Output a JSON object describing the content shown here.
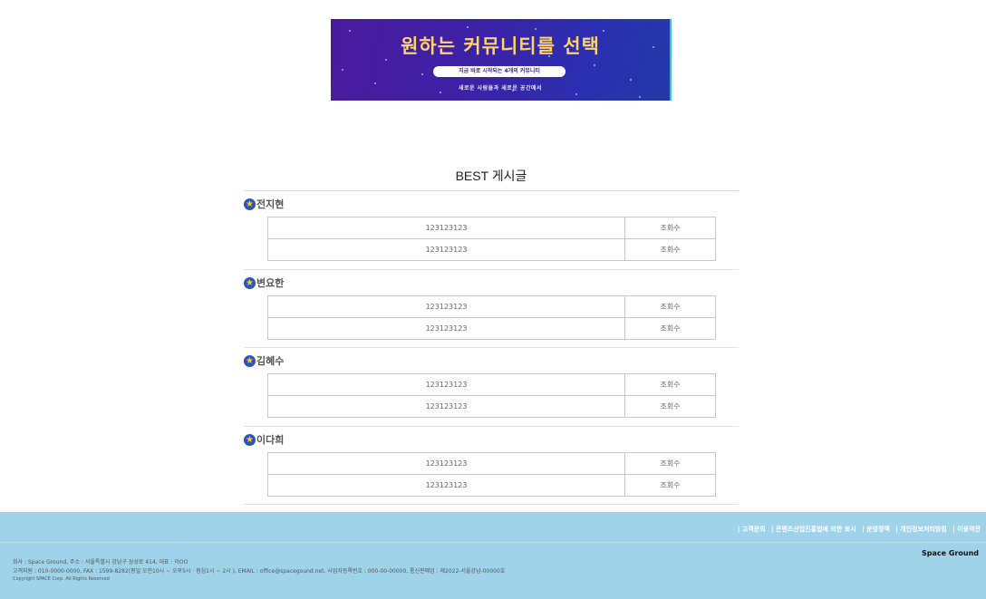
{
  "banner": {
    "title": "원하는 커뮤니티를 선택",
    "pill": "지금 바로 시작되는 4개의 커뮤니티",
    "subtitle": "새로운 사람들과 새로운 공간에서"
  },
  "best": {
    "title": "BEST 게시글",
    "groups": [
      {
        "author": "전지현",
        "posts": [
          {
            "title": "123123123",
            "views": "조회수"
          },
          {
            "title": "123123123",
            "views": "조회수"
          }
        ]
      },
      {
        "author": "변요한",
        "posts": [
          {
            "title": "123123123",
            "views": "조회수"
          },
          {
            "title": "123123123",
            "views": "조회수"
          }
        ]
      },
      {
        "author": "김혜수",
        "posts": [
          {
            "title": "123123123",
            "views": "조회수"
          },
          {
            "title": "123123123",
            "views": "조회수"
          }
        ]
      },
      {
        "author": "이다희",
        "posts": [
          {
            "title": "123123123",
            "views": "조회수"
          },
          {
            "title": "123123123",
            "views": "조회수"
          }
        ]
      }
    ]
  },
  "footer": {
    "links": [
      "| 고객문의",
      "| 콘텐츠산업진흥법에 의한 표시",
      "| 운영정책",
      "| 개인정보처리방침",
      "| 이용약관"
    ],
    "brand": "Space Ground",
    "info_line1": "회사 : Space Ground, 주소 : 서울특별시 강남구 삼성로 414, 대표 : 이OO",
    "info_line2": "고객지원 : 010-0000-0000, FAX : 1599-8282(평일 오전10시 ~ 오후5시 · 점심1시 ~ 2시 ), EMAIL : office@spacegound.net, 사업자등록번호 : 000-00-00000, 통신판매업 : 제2022-서울강남-00000호",
    "copyright": "Copyright SPACE Corp. All Rights Reserved"
  }
}
